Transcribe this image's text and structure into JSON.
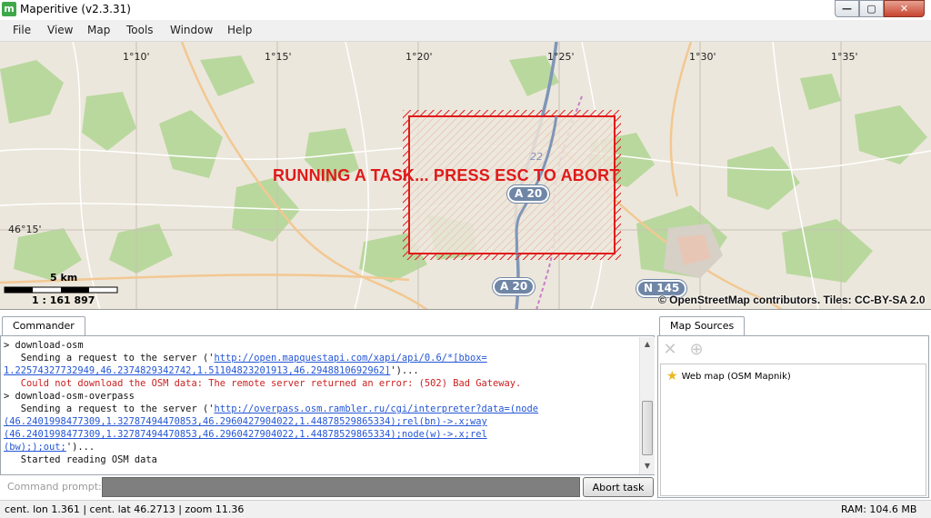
{
  "window": {
    "title": "Maperitive (v2.3.31)",
    "icon_letter": "m",
    "controls": {
      "minimize": "—",
      "maximize": "▢",
      "close": "✕"
    }
  },
  "menu": [
    "File",
    "View",
    "Map",
    "Tools",
    "Window",
    "Help"
  ],
  "map": {
    "longitude_labels": [
      "1°10'",
      "1°15'",
      "1°20'",
      "1°25'",
      "1°30'",
      "1°35'"
    ],
    "latitude_label": "46°15'",
    "task_message": "RUNNING A TASK... PRESS ESC TO ABORT",
    "road_badges": [
      "A 20",
      "A 20",
      "N 145"
    ],
    "road_number": "22",
    "scale_distance": "5 km",
    "scale_ratio": "1 : 161 897",
    "attribution": "© OpenStreetMap contributors. Tiles: CC-BY-SA 2.0",
    "colors": {
      "background": "#ece7dc",
      "forest": "#b7d79c",
      "highlight": "#e01a1a"
    }
  },
  "commander": {
    "tab_label": "Commander",
    "lines": [
      {
        "type": "cmd",
        "parts": [
          {
            "t": "> download-osm"
          }
        ]
      },
      {
        "type": "out",
        "parts": [
          {
            "t": "   Sending a request to the server ('"
          },
          {
            "t": "http://open.mapquestapi.com/xapi/api/0.6/*[bbox=",
            "link": true
          }
        ]
      },
      {
        "type": "out",
        "parts": [
          {
            "t": "1.22574327732949,46.2374829342742,1.51104823201913,46.2948810692962]",
            "link": true
          },
          {
            "t": "')..."
          }
        ]
      },
      {
        "type": "err",
        "parts": [
          {
            "t": "   Could not download the OSM data: The remote server returned an error: (502) Bad Gateway."
          }
        ]
      },
      {
        "type": "cmd",
        "parts": [
          {
            "t": "> download-osm-overpass"
          }
        ]
      },
      {
        "type": "out",
        "parts": [
          {
            "t": "   Sending a request to the server ('"
          },
          {
            "t": "http://overpass.osm.rambler.ru/cgi/interpreter?data=(node",
            "link": true
          }
        ]
      },
      {
        "type": "out",
        "parts": [
          {
            "t": "(46.2401998477309,1.32787494470853,46.2960427904022,1.44878529865334);rel(bn)->.x;way",
            "link": true
          }
        ]
      },
      {
        "type": "out",
        "parts": [
          {
            "t": "(46.2401998477309,1.32787494470853,46.2960427904022,1.44878529865334);node(w)->.x;rel",
            "link": true
          }
        ]
      },
      {
        "type": "out",
        "parts": [
          {
            "t": "(bw););out;",
            "link": true
          },
          {
            "t": "')..."
          }
        ]
      },
      {
        "type": "out",
        "parts": [
          {
            "t": "   Started reading OSM data"
          }
        ]
      }
    ],
    "prompt_label": "Command prompt:",
    "prompt_value": "",
    "abort_label": "Abort task"
  },
  "map_sources": {
    "tab_label": "Map Sources",
    "toolbar": {
      "remove_icon": "close-icon",
      "zoom_icon": "zoom-extent-icon"
    },
    "items": [
      {
        "label": "Web map (OSM Mapnik)",
        "icon": "star-icon"
      }
    ]
  },
  "status": {
    "position": "cent. lon 1.361 | cent. lat 46.2713 | zoom 11.36",
    "ram": "RAM: 104.6 MB"
  }
}
